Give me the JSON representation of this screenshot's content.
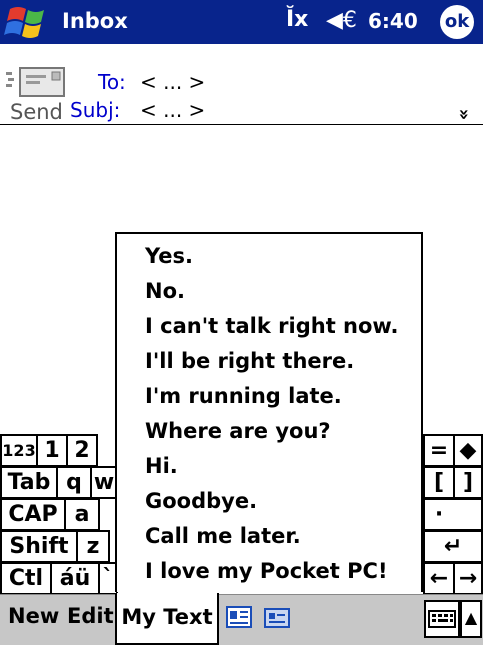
{
  "titlebar": {
    "app_title": "Inbox",
    "signal_icon": "antenna-signal-icon",
    "signal_glyph": "Ĭx",
    "volume_glyph": "◀€",
    "clock": "6:40",
    "ok_label": "ok"
  },
  "header": {
    "send_label": "Send",
    "to_label": "To:",
    "to_value": "< ... >",
    "subj_label": "Subj:",
    "subj_value": "< ... >",
    "expand_glyph": "»"
  },
  "keyboard": {
    "row1_left": [
      "123",
      "1",
      "2"
    ],
    "row1_right": [
      "=",
      "◆"
    ],
    "row2_left": [
      "Tab",
      "q",
      "w"
    ],
    "row2_right": [
      "[",
      "]"
    ],
    "row3_left": [
      "CAP",
      "a"
    ],
    "row3_right": [
      "'",
      "·"
    ],
    "row4_left": [
      "Shift",
      "z"
    ],
    "row4_right": [
      "",
      "↵"
    ],
    "row5_left": [
      "Ctl",
      "áü",
      "`"
    ],
    "row5_right": [
      "←",
      "→"
    ]
  },
  "popup": {
    "items": [
      "Yes.",
      "No.",
      "I can't talk right now.",
      "I'll be right there.",
      "I'm running late.",
      "Where are you?",
      "Hi.",
      "Goodbye.",
      "Call me later.",
      "I love my Pocket PC!"
    ]
  },
  "menubar": {
    "new_label": "New",
    "edit_label": "Edit",
    "mytext_label": "My Text",
    "arrow_glyph": "▲"
  },
  "colors": {
    "titlebar_bg": "#08248c",
    "link_blue": "#0000cc",
    "menubar_bg": "#c7c7c7"
  }
}
